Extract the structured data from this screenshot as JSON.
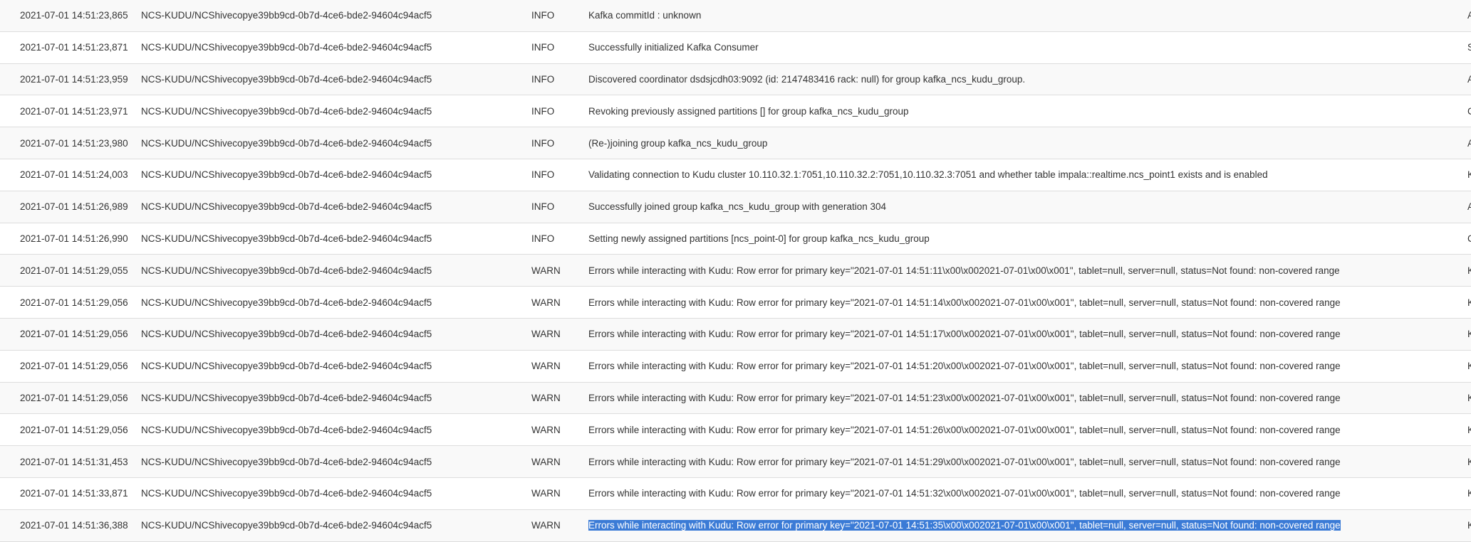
{
  "log": {
    "rows": [
      {
        "time": "2021-07-01 14:51:23,865",
        "source": "NCS-KUDU/NCShivecopye39bb9cd-0b7d-4ce6-bde2-94604c94acf5",
        "level": "INFO",
        "message": "Kafka commitId : unknown",
        "cls": "Ap"
      },
      {
        "time": "2021-07-01 14:51:23,871",
        "source": "NCS-KUDU/NCShivecopye39bb9cd-0b7d-4ce6-bde2-94604c94acf5",
        "level": "INFO",
        "message": "Successfully initialized Kafka Consumer",
        "cls": "Sta"
      },
      {
        "time": "2021-07-01 14:51:23,959",
        "source": "NCS-KUDU/NCShivecopye39bb9cd-0b7d-4ce6-bde2-94604c94acf5",
        "level": "INFO",
        "message": "Discovered coordinator dsdsjcdh03:9092 (id: 2147483416 rack: null) for group kafka_ncs_kudu_group.",
        "cls": "Abs"
      },
      {
        "time": "2021-07-01 14:51:23,971",
        "source": "NCS-KUDU/NCShivecopye39bb9cd-0b7d-4ce6-bde2-94604c94acf5",
        "level": "INFO",
        "message": "Revoking previously assigned partitions [] for group kafka_ncs_kudu_group",
        "cls": "Co"
      },
      {
        "time": "2021-07-01 14:51:23,980",
        "source": "NCS-KUDU/NCShivecopye39bb9cd-0b7d-4ce6-bde2-94604c94acf5",
        "level": "INFO",
        "message": "(Re-)joining group kafka_ncs_kudu_group",
        "cls": "Abs"
      },
      {
        "time": "2021-07-01 14:51:24,003",
        "source": "NCS-KUDU/NCShivecopye39bb9cd-0b7d-4ce6-bde2-94604c94acf5",
        "level": "INFO",
        "message": "Validating connection to Kudu cluster 10.110.32.1:7051,10.110.32.2:7051,10.110.32.3:7051 and whether table impala::realtime.ncs_point1 exists and is enabled",
        "cls": "Ku"
      },
      {
        "time": "2021-07-01 14:51:26,989",
        "source": "NCS-KUDU/NCShivecopye39bb9cd-0b7d-4ce6-bde2-94604c94acf5",
        "level": "INFO",
        "message": "Successfully joined group kafka_ncs_kudu_group with generation 304",
        "cls": "Abs"
      },
      {
        "time": "2021-07-01 14:51:26,990",
        "source": "NCS-KUDU/NCShivecopye39bb9cd-0b7d-4ce6-bde2-94604c94acf5",
        "level": "INFO",
        "message": "Setting newly assigned partitions [ncs_point-0] for group kafka_ncs_kudu_group",
        "cls": "Co"
      },
      {
        "time": "2021-07-01 14:51:29,055",
        "source": "NCS-KUDU/NCShivecopye39bb9cd-0b7d-4ce6-bde2-94604c94acf5",
        "level": "WARN",
        "message": "Errors while interacting with Kudu: Row error for primary key=\"2021-07-01 14:51:11\\x00\\x002021-07-01\\x00\\x001\", tablet=null, server=null, status=Not found: non-covered range",
        "cls": "Ku"
      },
      {
        "time": "2021-07-01 14:51:29,056",
        "source": "NCS-KUDU/NCShivecopye39bb9cd-0b7d-4ce6-bde2-94604c94acf5",
        "level": "WARN",
        "message": "Errors while interacting with Kudu: Row error for primary key=\"2021-07-01 14:51:14\\x00\\x002021-07-01\\x00\\x001\", tablet=null, server=null, status=Not found: non-covered range",
        "cls": "Ku"
      },
      {
        "time": "2021-07-01 14:51:29,056",
        "source": "NCS-KUDU/NCShivecopye39bb9cd-0b7d-4ce6-bde2-94604c94acf5",
        "level": "WARN",
        "message": "Errors while interacting with Kudu: Row error for primary key=\"2021-07-01 14:51:17\\x00\\x002021-07-01\\x00\\x001\", tablet=null, server=null, status=Not found: non-covered range",
        "cls": "Ku"
      },
      {
        "time": "2021-07-01 14:51:29,056",
        "source": "NCS-KUDU/NCShivecopye39bb9cd-0b7d-4ce6-bde2-94604c94acf5",
        "level": "WARN",
        "message": "Errors while interacting with Kudu: Row error for primary key=\"2021-07-01 14:51:20\\x00\\x002021-07-01\\x00\\x001\", tablet=null, server=null, status=Not found: non-covered range",
        "cls": "Ku"
      },
      {
        "time": "2021-07-01 14:51:29,056",
        "source": "NCS-KUDU/NCShivecopye39bb9cd-0b7d-4ce6-bde2-94604c94acf5",
        "level": "WARN",
        "message": "Errors while interacting with Kudu: Row error for primary key=\"2021-07-01 14:51:23\\x00\\x002021-07-01\\x00\\x001\", tablet=null, server=null, status=Not found: non-covered range",
        "cls": "Ku"
      },
      {
        "time": "2021-07-01 14:51:29,056",
        "source": "NCS-KUDU/NCShivecopye39bb9cd-0b7d-4ce6-bde2-94604c94acf5",
        "level": "WARN",
        "message": "Errors while interacting with Kudu: Row error for primary key=\"2021-07-01 14:51:26\\x00\\x002021-07-01\\x00\\x001\", tablet=null, server=null, status=Not found: non-covered range",
        "cls": "Ku"
      },
      {
        "time": "2021-07-01 14:51:31,453",
        "source": "NCS-KUDU/NCShivecopye39bb9cd-0b7d-4ce6-bde2-94604c94acf5",
        "level": "WARN",
        "message": "Errors while interacting with Kudu: Row error for primary key=\"2021-07-01 14:51:29\\x00\\x002021-07-01\\x00\\x001\", tablet=null, server=null, status=Not found: non-covered range",
        "cls": "Ku"
      },
      {
        "time": "2021-07-01 14:51:33,871",
        "source": "NCS-KUDU/NCShivecopye39bb9cd-0b7d-4ce6-bde2-94604c94acf5",
        "level": "WARN",
        "message": "Errors while interacting with Kudu: Row error for primary key=\"2021-07-01 14:51:32\\x00\\x002021-07-01\\x00\\x001\", tablet=null, server=null, status=Not found: non-covered range",
        "cls": "Ku"
      },
      {
        "time": "2021-07-01 14:51:36,388",
        "source": "NCS-KUDU/NCShivecopye39bb9cd-0b7d-4ce6-bde2-94604c94acf5",
        "level": "WARN",
        "message": "Errors while interacting with Kudu: Row error for primary key=\"2021-07-01 14:51:35\\x00\\x002021-07-01\\x00\\x001\", tablet=null, server=null, status=Not found: non-covered range",
        "cls": "Ku",
        "selected": true
      }
    ]
  }
}
